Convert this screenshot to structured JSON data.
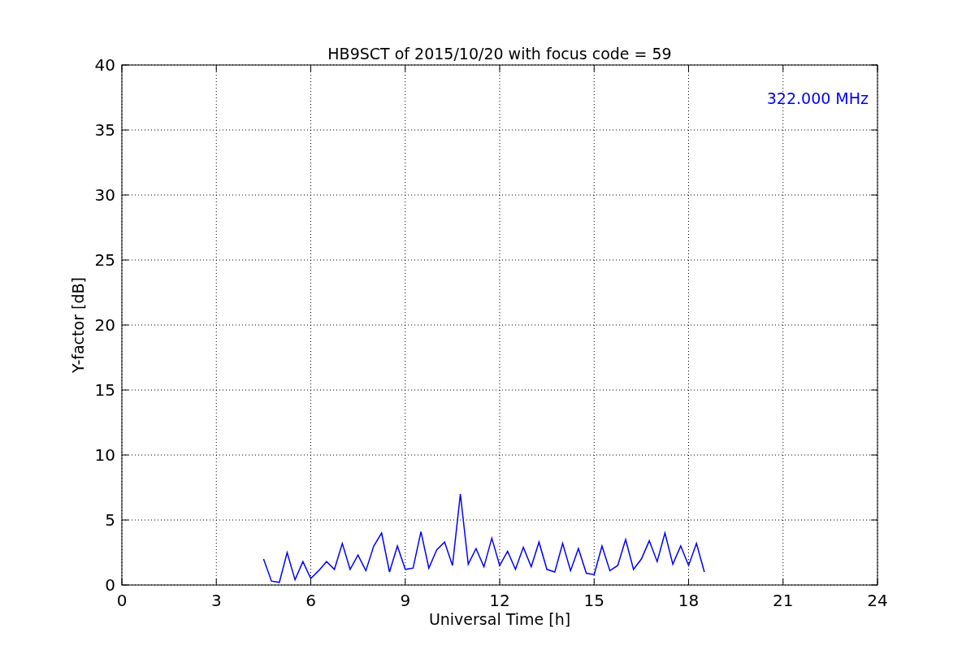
{
  "chart_data": {
    "type": "line",
    "title": "HB9SCT of 2015/10/20 with focus code = 59",
    "xlabel": "Universal Time [h]",
    "ylabel": "Y-factor [dB]",
    "x": [
      4.5,
      4.75,
      5.0,
      5.25,
      5.5,
      5.75,
      6.0,
      6.25,
      6.5,
      6.75,
      7.0,
      7.25,
      7.5,
      7.75,
      8.0,
      8.25,
      8.5,
      8.75,
      9.0,
      9.25,
      9.5,
      9.75,
      10.0,
      10.25,
      10.5,
      10.75,
      11.0,
      11.25,
      11.5,
      11.75,
      12.0,
      12.25,
      12.5,
      12.75,
      13.0,
      13.25,
      13.5,
      13.75,
      14.0,
      14.25,
      14.5,
      14.75,
      15.0,
      15.25,
      15.5,
      15.75,
      16.0,
      16.25,
      16.5,
      16.75,
      17.0,
      17.25,
      17.5,
      17.75,
      18.0,
      18.25,
      18.5
    ],
    "series": [
      {
        "name": "322.000 MHz",
        "color": "#0000ff",
        "values": [
          2.0,
          0.3,
          0.2,
          2.5,
          0.4,
          1.8,
          0.5,
          1.1,
          1.8,
          1.2,
          3.2,
          1.2,
          2.3,
          1.1,
          3.0,
          4.0,
          1.0,
          3.0,
          1.2,
          1.3,
          4.1,
          1.3,
          2.7,
          3.3,
          1.5,
          7.0,
          1.6,
          2.8,
          1.4,
          3.6,
          1.5,
          2.6,
          1.2,
          2.9,
          1.4,
          3.3,
          1.2,
          1.0,
          3.2,
          1.1,
          2.8,
          0.9,
          0.8,
          3.0,
          1.1,
          1.5,
          3.5,
          1.2,
          2.0,
          3.4,
          1.8,
          4.0,
          1.6,
          3.0,
          1.5,
          3.2,
          1.0
        ]
      }
    ],
    "xlim": [
      0,
      24
    ],
    "ylim": [
      0,
      40
    ],
    "xticks": [
      0,
      3,
      6,
      9,
      12,
      15,
      18,
      21,
      24
    ],
    "yticks": [
      0,
      5,
      10,
      15,
      20,
      25,
      30,
      35,
      40
    ],
    "grid": true
  }
}
